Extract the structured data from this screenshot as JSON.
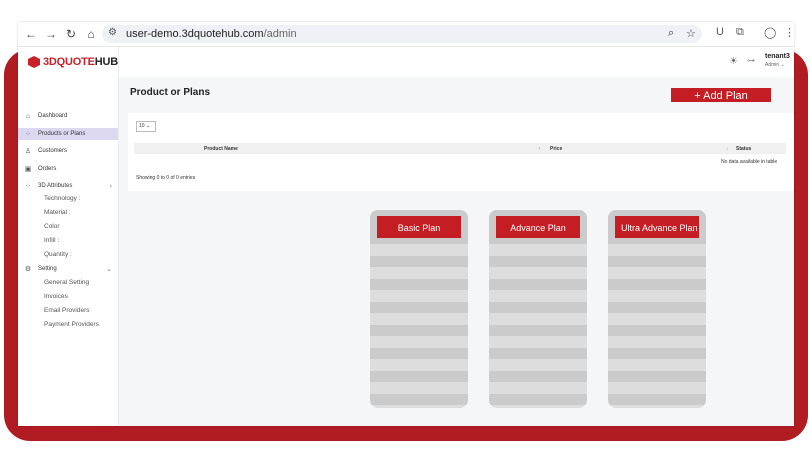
{
  "browser": {
    "url_host": "user-demo.3dquotehub.com",
    "url_path": "/admin"
  },
  "app": {
    "logo": {
      "prefix": "3D",
      "quote": "QUOTE",
      "hub": "HUB"
    },
    "user": {
      "name": "tenant3",
      "role": "Admin ⌄"
    }
  },
  "sidebar": {
    "items": [
      {
        "label": "Dashboard",
        "icon": "home-icon"
      },
      {
        "label": "Products or Plans",
        "icon": "grid-icon"
      },
      {
        "label": "Customers",
        "icon": "user-icon"
      },
      {
        "label": "Orders",
        "icon": "box-icon"
      },
      {
        "label": "3D Attributes",
        "icon": "grid-icon"
      },
      {
        "label": "Setting",
        "icon": "gear-icon"
      }
    ],
    "attributes": [
      "Technology :",
      "Material :",
      "Color",
      "Infill :",
      "Quantity :"
    ],
    "settings": [
      "General Setting",
      "Invoices",
      "Email Providers",
      "Payment Providers"
    ]
  },
  "main": {
    "title": "Product or Plans",
    "add_button": "+ Add Plan",
    "page_size": "10 ⌄",
    "columns": [
      "Product Name",
      "Price",
      "Status"
    ],
    "empty_text": "No data available in table",
    "showing": "Showing 0 to 0 of 0 entries"
  },
  "plans": [
    "Basic Plan",
    "Advance Plan",
    "Ultra Advance Plan"
  ],
  "colors": {
    "brand": "#c41e24",
    "frame": "#b01c22",
    "active": "#dcd8f0"
  }
}
